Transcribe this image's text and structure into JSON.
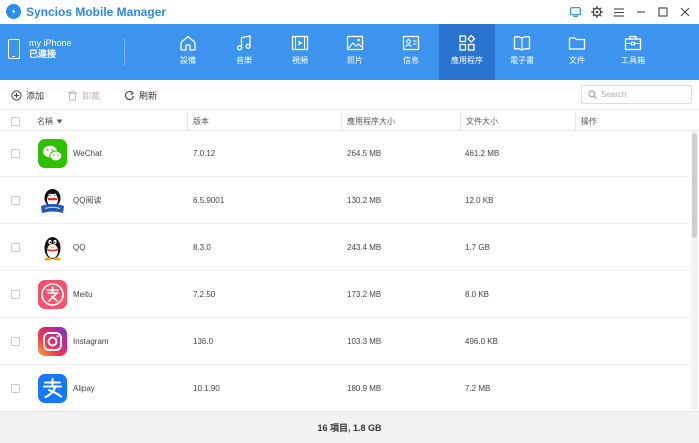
{
  "app": {
    "title": "Syncios Mobile Manager"
  },
  "device": {
    "name": "my iPhone",
    "status": "已連接"
  },
  "nav": [
    {
      "label": "設備",
      "icon": "home-icon"
    },
    {
      "label": "音樂",
      "icon": "music-note-icon"
    },
    {
      "label": "視頻",
      "icon": "film-icon"
    },
    {
      "label": "照片",
      "icon": "image-icon"
    },
    {
      "label": "信息",
      "icon": "contact-card-icon"
    },
    {
      "label": "應用程序",
      "icon": "apps-grid-icon",
      "active": true
    },
    {
      "label": "電子書",
      "icon": "book-icon"
    },
    {
      "label": "文件",
      "icon": "folder-icon"
    },
    {
      "label": "工具箱",
      "icon": "toolbox-icon"
    }
  ],
  "toolbar": {
    "add_label": "添加",
    "uninstall_label": "卸載",
    "refresh_label": "刷新"
  },
  "search": {
    "placeholder": "Search"
  },
  "table": {
    "columns": {
      "name": "名稱",
      "version": "版本",
      "app_size": "應用程序大小",
      "doc_size": "文件大小",
      "action": "操作"
    },
    "rows": [
      {
        "name": "WeChat",
        "version": "7.0.12",
        "app_size": "264.5 MB",
        "doc_size": "461.2 MB",
        "icon": "wechat-icon"
      },
      {
        "name": "QQ阅读",
        "version": "6.5.9001",
        "app_size": "130.2 MB",
        "doc_size": "12.0 KB",
        "icon": "qq-reader-icon"
      },
      {
        "name": "QQ",
        "version": "8.3.0",
        "app_size": "243.4 MB",
        "doc_size": "1.7 GB",
        "icon": "qq-penguin-icon"
      },
      {
        "name": "Meitu",
        "version": "7.2.50",
        "app_size": "173.2 MB",
        "doc_size": "8.0 KB",
        "icon": "meitu-icon"
      },
      {
        "name": "Instagram",
        "version": "136.0",
        "app_size": "103.3 MB",
        "doc_size": "496.0 KB",
        "icon": "instagram-icon"
      },
      {
        "name": "Alipay",
        "version": "10.1.90",
        "app_size": "180.9 MB",
        "doc_size": "7.2 MB",
        "icon": "alipay-icon"
      }
    ]
  },
  "footer": {
    "summary": "16 項目, 1.8 GB"
  },
  "colors": {
    "brand": "#2f88ea",
    "nav_bg": "#3d94ef",
    "nav_active": "#2a73cf"
  }
}
